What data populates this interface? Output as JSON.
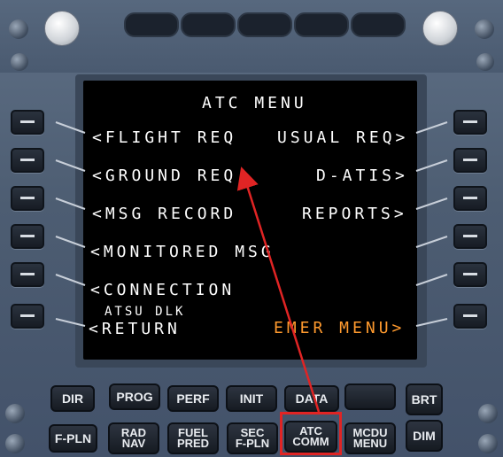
{
  "screen": {
    "title": "ATC MENU",
    "left_items": [
      "<FLIGHT REQ",
      "<GROUND REQ",
      "<MSG RECORD",
      "<MONITORED MSG",
      "<CONNECTION"
    ],
    "right_items": [
      "USUAL REQ>",
      "D-ATIS>",
      "REPORTS>"
    ],
    "small_label": "ATSU DLK",
    "return_label": "<RETURN",
    "emer_label": "EMER MENU>"
  },
  "keys": {
    "dir": "DIR",
    "prog": "PROG",
    "perf": "PERF",
    "init": "INIT",
    "data": "DATA",
    "brt": "BRT",
    "fpln": "F-PLN",
    "radnav_1": "RAD",
    "radnav_2": "NAV",
    "fuelpred_1": "FUEL",
    "fuelpred_2": "PRED",
    "secfpln_1": "SEC",
    "secfpln_2": "F-PLN",
    "atccomm_1": "ATC",
    "atccomm_2": "COMM",
    "mcdumenu_1": "MCDU",
    "mcdumenu_2": "MENU",
    "dim": "DIM"
  },
  "annotation": {
    "color": "#e02424",
    "emer_color": "#ff9a2e"
  }
}
